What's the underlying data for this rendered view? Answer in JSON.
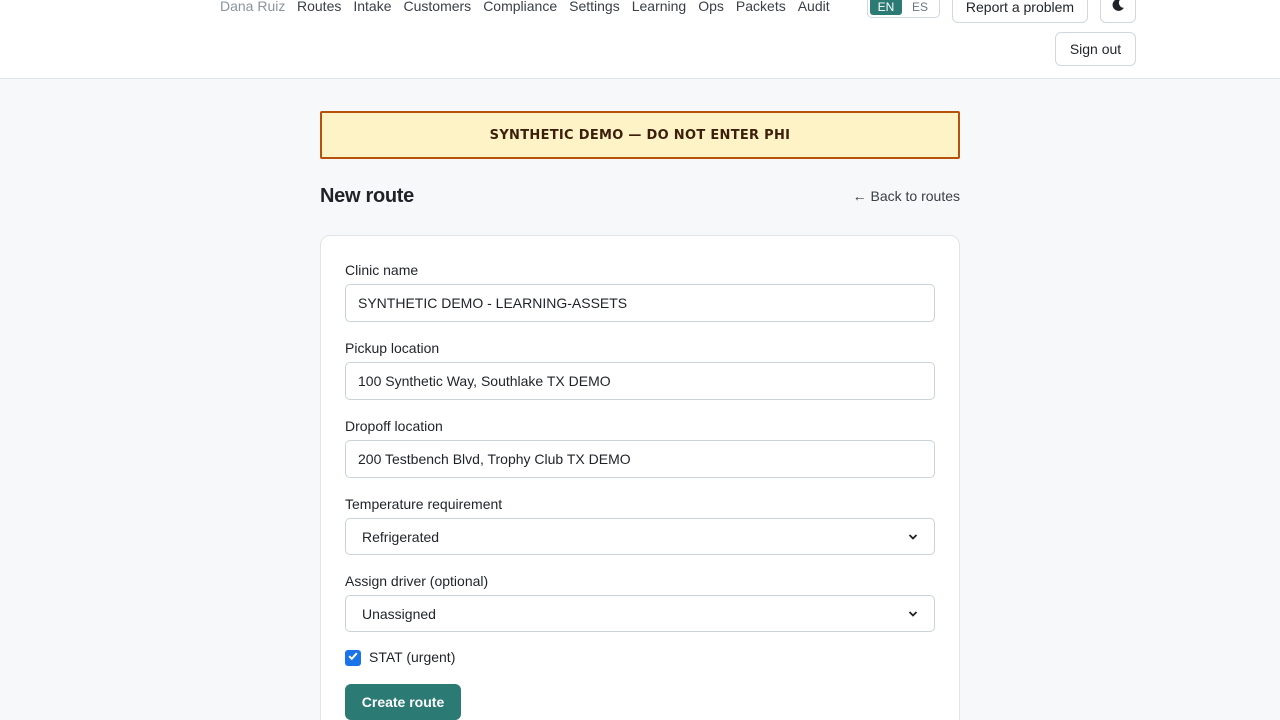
{
  "header": {
    "user_name": "Dana Ruiz",
    "nav": [
      "Routes",
      "Intake",
      "Customers",
      "Compliance",
      "Settings",
      "Learning",
      "Ops",
      "Packets",
      "Audit"
    ],
    "lang_active": "EN",
    "lang_inactive": "ES",
    "report_label": "Report a problem",
    "theme_icon": "moon-icon",
    "signout_label": "Sign out"
  },
  "banner": "SYNTHETIC DEMO — DO NOT ENTER PHI",
  "page": {
    "title": "New route",
    "back_link": "← Back to routes"
  },
  "form": {
    "clinic_label": "Clinic name",
    "clinic_value": "SYNTHETIC DEMO - LEARNING-ASSETS",
    "pickup_label": "Pickup location",
    "pickup_value": "100 Synthetic Way, Southlake TX DEMO",
    "dropoff_label": "Dropoff location",
    "dropoff_value": "200 Testbench Blvd, Trophy Club TX DEMO",
    "temp_label": "Temperature requirement",
    "temp_value": "Refrigerated",
    "driver_label": "Assign driver (optional)",
    "driver_value": "Unassigned",
    "stat_label": "STAT (urgent)",
    "stat_checked": true,
    "submit_label": "Create route"
  },
  "colors": {
    "accent": "#2c7a74",
    "banner_bg": "#fef3c7",
    "banner_border": "#b45309",
    "checkbox": "#1a73e8"
  }
}
